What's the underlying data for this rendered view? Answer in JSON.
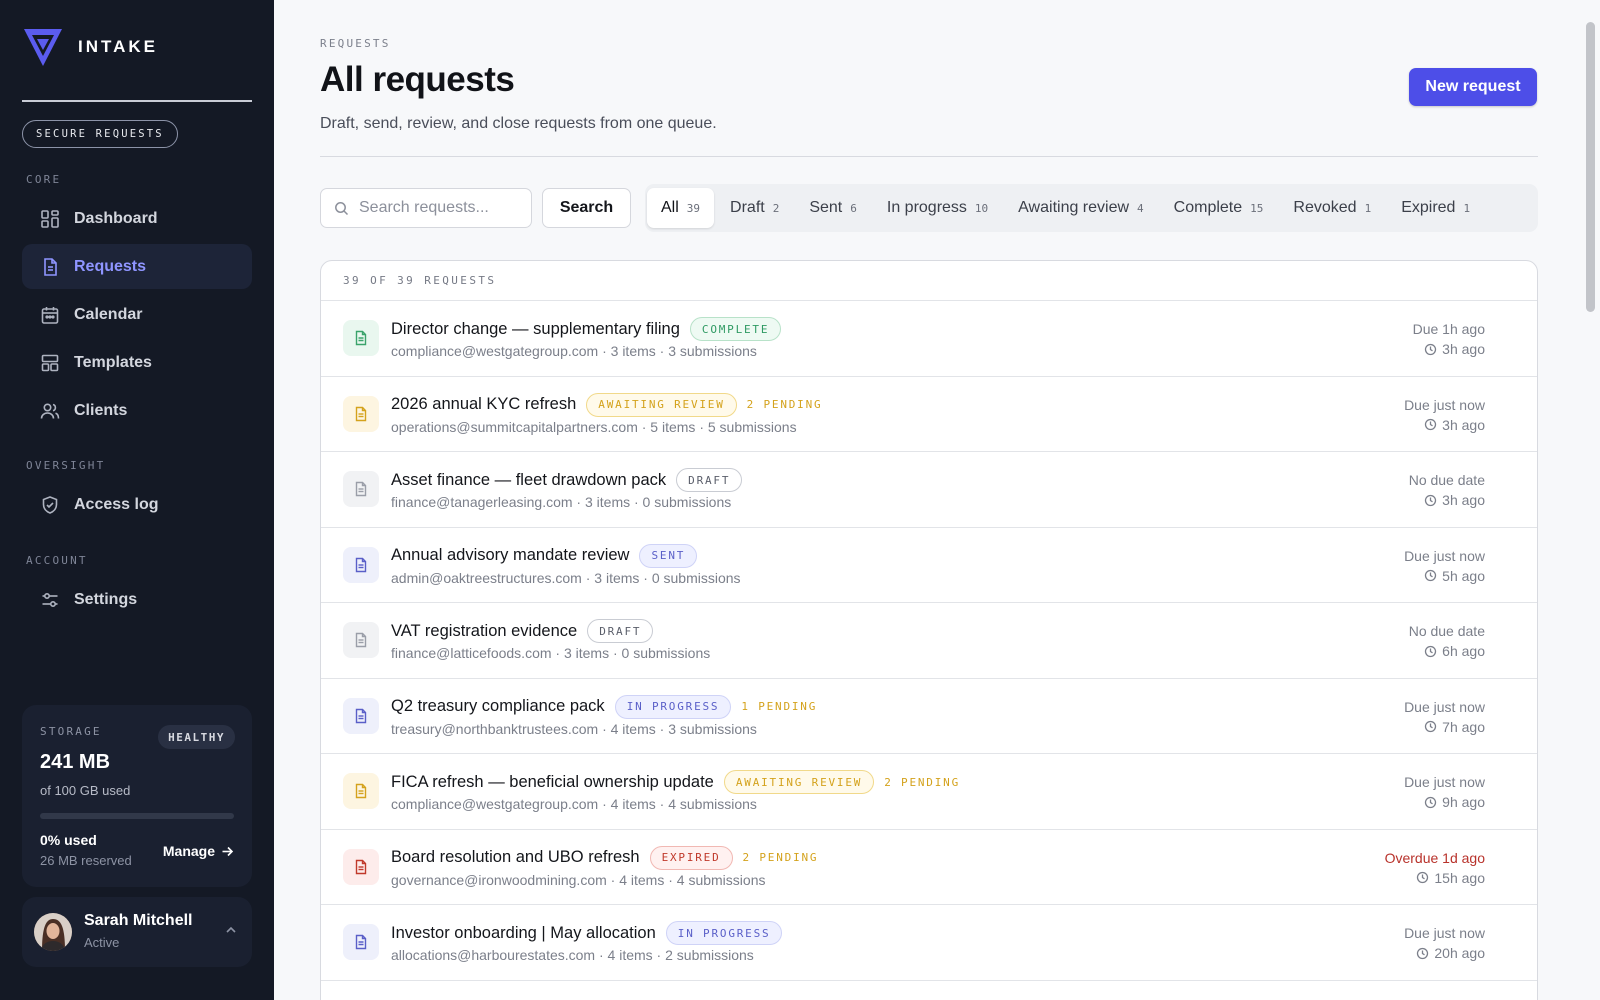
{
  "brand": {
    "name": "INTAKE",
    "tagline": "SECURE REQUESTS"
  },
  "sidebar": {
    "sections": [
      {
        "title": "CORE"
      },
      {
        "title": "OVERSIGHT"
      },
      {
        "title": "ACCOUNT"
      }
    ],
    "items": [
      {
        "label": "Dashboard",
        "icon": "grid-icon"
      },
      {
        "label": "Requests",
        "icon": "document-icon",
        "active": true
      },
      {
        "label": "Calendar",
        "icon": "calendar-icon"
      },
      {
        "label": "Templates",
        "icon": "template-icon"
      },
      {
        "label": "Clients",
        "icon": "users-icon"
      },
      {
        "label": "Access log",
        "icon": "shield-icon"
      },
      {
        "label": "Settings",
        "icon": "sliders-icon"
      }
    ]
  },
  "storage": {
    "label": "STORAGE",
    "badge": "HEALTHY",
    "value": "241 MB",
    "sub": "of 100 GB used",
    "used_fraction": 0,
    "used_label": "0% used",
    "reserved": "26 MB reserved",
    "manage": "Manage"
  },
  "user": {
    "name": "Sarah Mitchell",
    "status": "Active"
  },
  "header": {
    "breadcrumb": "REQUESTS",
    "title": "All requests",
    "subtitle": "Draft, send, review, and close requests from one queue.",
    "new_button": "New request"
  },
  "search": {
    "placeholder": "Search requests...",
    "value": "",
    "button": "Search"
  },
  "tabs": [
    {
      "label": "All",
      "count": "39",
      "active": true
    },
    {
      "label": "Draft",
      "count": "2"
    },
    {
      "label": "Sent",
      "count": "6"
    },
    {
      "label": "In progress",
      "count": "10"
    },
    {
      "label": "Awaiting review",
      "count": "4"
    },
    {
      "label": "Complete",
      "count": "15"
    },
    {
      "label": "Revoked",
      "count": "1"
    },
    {
      "label": "Expired",
      "count": "1"
    }
  ],
  "list": {
    "count_label": "39 OF 39 REQUESTS",
    "rows": [
      {
        "title": "Director change — supplementary filing",
        "status": "COMPLETE",
        "pending": "",
        "meta": "compliance@westgategroup.com · 3 items · 3 submissions",
        "due": "Due 1h ago",
        "time": "3h ago",
        "overdue": false
      },
      {
        "title": "2026 annual KYC refresh",
        "status": "AWAITING REVIEW",
        "pending": "2 PENDING",
        "meta": "operations@summitcapitalpartners.com · 5 items · 5 submissions",
        "due": "Due just now",
        "time": "3h ago",
        "overdue": false
      },
      {
        "title": "Asset finance — fleet drawdown pack",
        "status": "DRAFT",
        "pending": "",
        "meta": "finance@tanagerleasing.com · 3 items · 0 submissions",
        "due": "No due date",
        "time": "3h ago",
        "overdue": false
      },
      {
        "title": "Annual advisory mandate review",
        "status": "SENT",
        "pending": "",
        "meta": "admin@oaktreestructures.com · 3 items · 0 submissions",
        "due": "Due just now",
        "time": "5h ago",
        "overdue": false
      },
      {
        "title": "VAT registration evidence",
        "status": "DRAFT",
        "pending": "",
        "meta": "finance@latticefoods.com · 3 items · 0 submissions",
        "due": "No due date",
        "time": "6h ago",
        "overdue": false
      },
      {
        "title": "Q2 treasury compliance pack",
        "status": "IN PROGRESS",
        "pending": "1 PENDING",
        "meta": "treasury@northbanktrustees.com · 4 items · 3 submissions",
        "due": "Due just now",
        "time": "7h ago",
        "overdue": false
      },
      {
        "title": "FICA refresh — beneficial ownership update",
        "status": "AWAITING REVIEW",
        "pending": "2 PENDING",
        "meta": "compliance@westgategroup.com · 4 items · 4 submissions",
        "due": "Due just now",
        "time": "9h ago",
        "overdue": false
      },
      {
        "title": "Board resolution and UBO refresh",
        "status": "EXPIRED",
        "pending": "2 PENDING",
        "meta": "governance@ironwoodmining.com · 4 items · 4 submissions",
        "due": "Overdue 1d ago",
        "time": "15h ago",
        "overdue": true
      },
      {
        "title": "Investor onboarding | May allocation",
        "status": "IN PROGRESS",
        "pending": "",
        "meta": "allocations@harbourestates.com · 4 items · 2 submissions",
        "due": "Due just now",
        "time": "20h ago",
        "overdue": false
      }
    ]
  },
  "colors": {
    "accent": "#4d4ee8",
    "sidebar_bg": "#141925",
    "complete": "#2f9a63",
    "awaiting": "#d4a21c",
    "draft": "#5a5e6a",
    "sent": "#5a5fc8",
    "in_progress": "#5a5fc8",
    "expired": "#c0392b"
  }
}
